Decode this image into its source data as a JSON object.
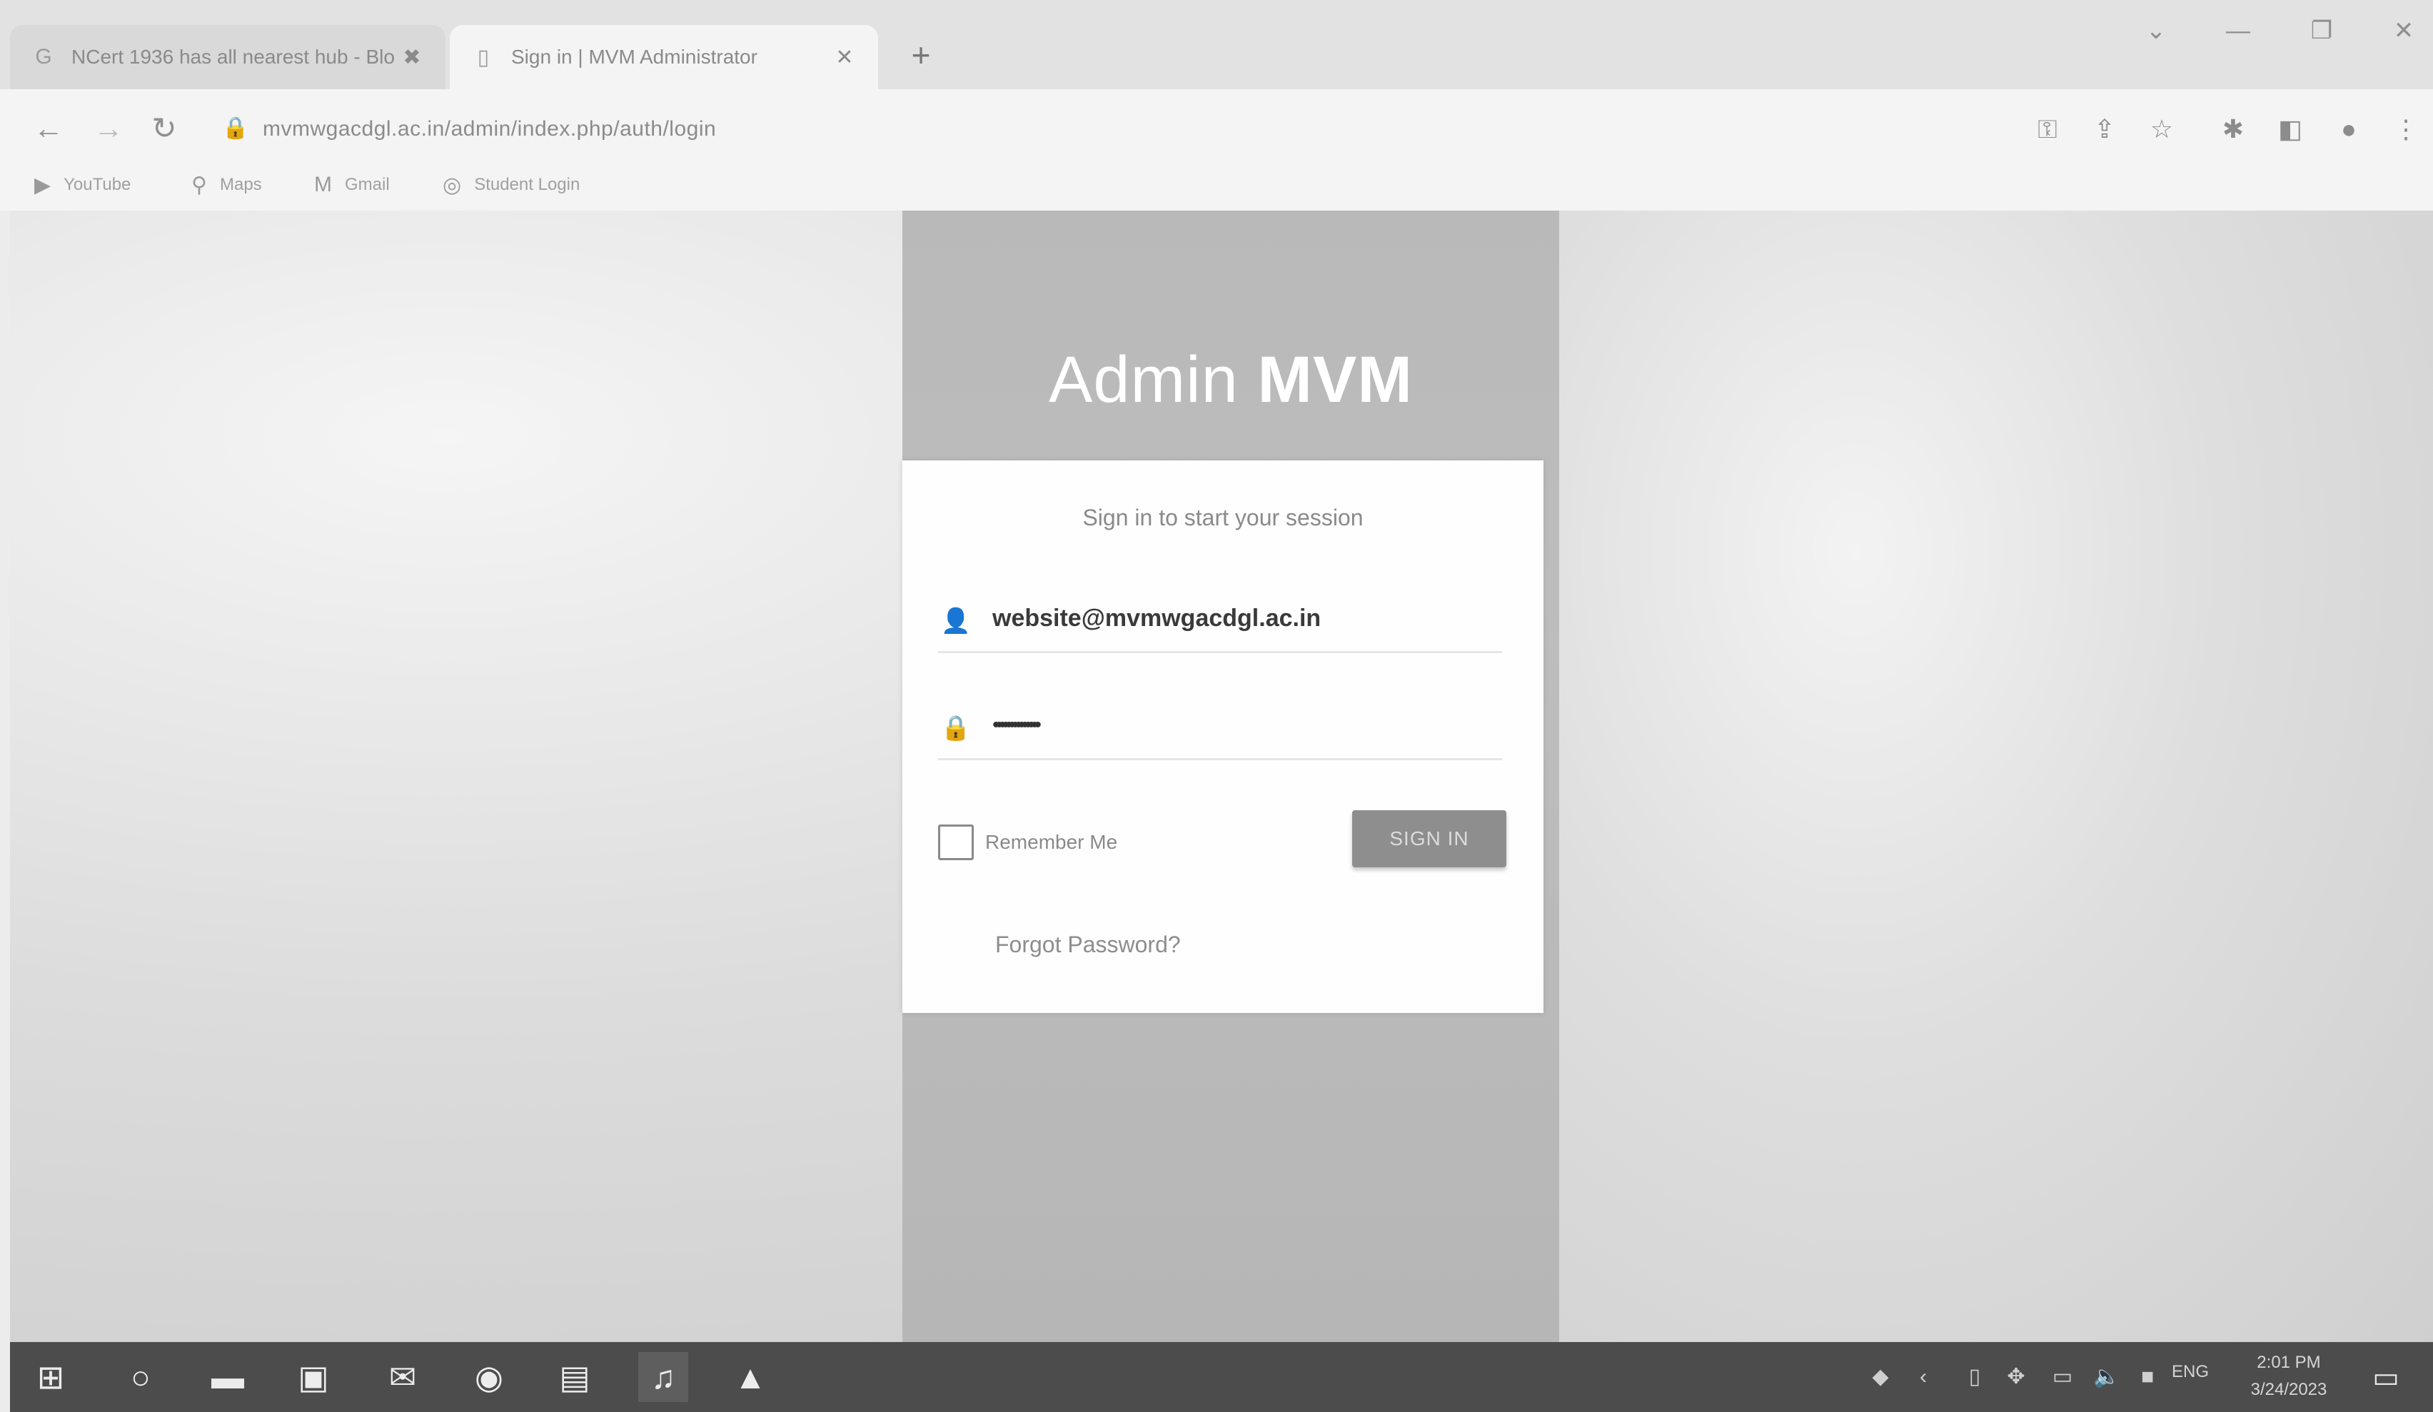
{
  "browser": {
    "tabs": [
      {
        "title": "NCert 1936 has all nearest hub - Blo",
        "favicon": "google-icon",
        "close": "✖"
      },
      {
        "title": "Sign in | MVM Administrator",
        "favicon": "page-icon",
        "close": "✕"
      }
    ],
    "new_tab": "+",
    "window_controls": {
      "dropdown": "⌄",
      "minimize": "—",
      "restore": "❐",
      "close": "✕"
    },
    "nav": {
      "back": "←",
      "forward": "→",
      "reload": "↻"
    },
    "url": "mvmwgacdgl.ac.in/admin/index.php/auth/login",
    "bookmarks": [
      {
        "label": "YouTube",
        "icon": "youtube-icon"
      },
      {
        "label": "Maps",
        "icon": "map-pin-icon"
      },
      {
        "label": "Gmail",
        "icon": "gmail-icon"
      },
      {
        "label": "Student Login",
        "icon": "globe-icon"
      }
    ]
  },
  "login": {
    "brand_light": "Admin ",
    "brand_bold": "MVM",
    "message": "Sign in to start your session",
    "email_value": "website@mvmwgacdgl.ac.in",
    "password_value": "••••••••••••••",
    "remember_label": "Remember Me",
    "signin_label": "SIGN IN",
    "forgot_label": "Forgot Password?"
  },
  "taskbar": {
    "language": "ENG",
    "time": "2:01 PM",
    "date": "3/24/2023"
  },
  "colors": {
    "brand_column": "#bababa",
    "signin_button": "#8e8e8e",
    "taskbar": "#4c4c4c"
  }
}
